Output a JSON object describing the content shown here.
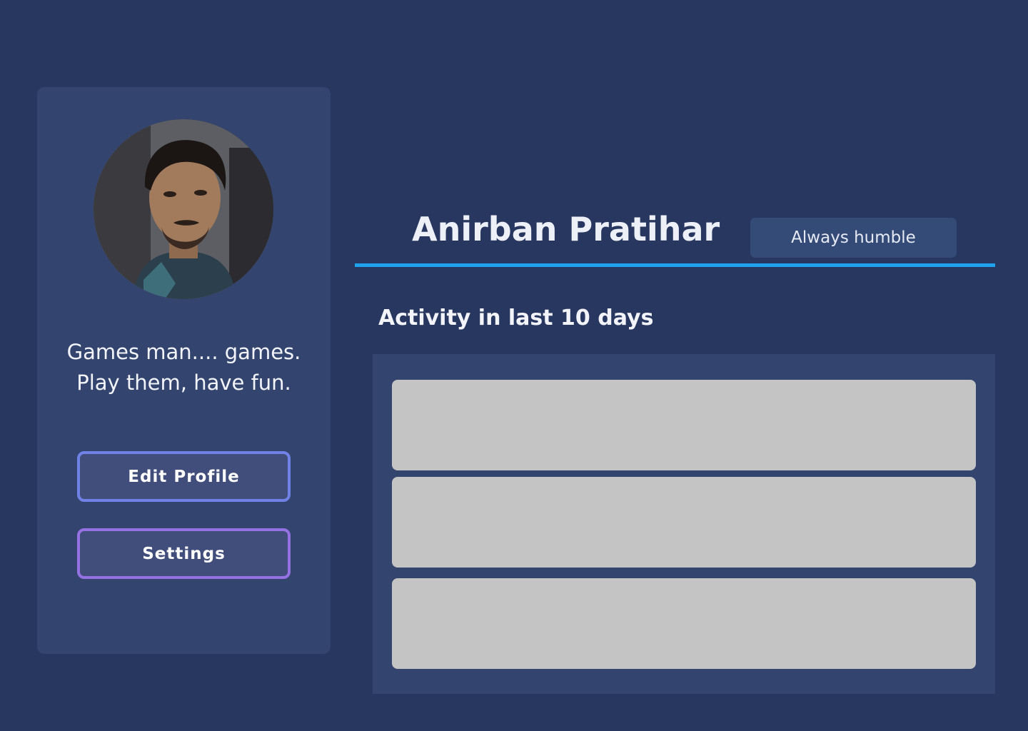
{
  "profile": {
    "name": "Anirban Pratihar",
    "status": "Always humble",
    "bio_line1": "Games man.... games.",
    "bio_line2": "Play them, have fun.",
    "avatar_alt": "Profile photo"
  },
  "actions": {
    "edit_label": "Edit Profile",
    "settings_label": "Settings"
  },
  "activity": {
    "title": "Activity in last 10 days",
    "items": [
      "",
      "",
      ""
    ]
  },
  "colors": {
    "background": "#283760",
    "card": "#33446f",
    "accent_divider": "#1ea2ee",
    "edit_border": "#7082e6",
    "settings_border": "#9572e4",
    "placeholder": "#c4c4c4"
  }
}
